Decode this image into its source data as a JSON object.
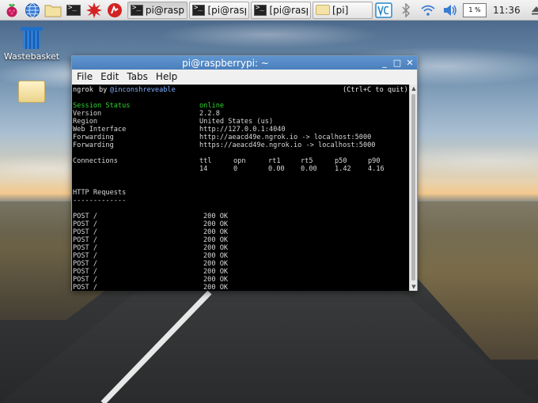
{
  "taskbar": {
    "tasks": [
      {
        "label": "pi@raspb",
        "kind": "terminal",
        "active": true
      },
      {
        "label": "[pi@rasp",
        "kind": "terminal",
        "active": false
      },
      {
        "label": "[pi@rasp",
        "kind": "terminal",
        "active": false
      },
      {
        "label": "[pi]",
        "kind": "folder",
        "active": false
      }
    ],
    "cpu": "1 %",
    "clock": "11:36"
  },
  "desktop": {
    "icons": [
      {
        "label": "Wastebasket",
        "icon": "wastebasket-icon"
      },
      {
        "label": "",
        "icon": "folder-icon"
      }
    ]
  },
  "window": {
    "title": "pi@raspberrypi: ~",
    "menu": [
      "File",
      "Edit",
      "Tabs",
      "Help"
    ]
  },
  "terminal": {
    "header": {
      "name": "ngrok",
      "by": "by",
      "author": "@inconshreveable",
      "quit_hint": "(Ctrl+C to quit)"
    },
    "status": [
      {
        "label": "Session Status",
        "value": "online"
      },
      {
        "label": "Version",
        "value": "2.2.8"
      },
      {
        "label": "Region",
        "value": "United States (us)"
      },
      {
        "label": "Web Interface",
        "value": "http://127.0.0.1:4040"
      },
      {
        "label": "Forwarding",
        "value": "http://aeacd49e.ngrok.io -> localhost:5000"
      },
      {
        "label": "Forwarding",
        "value": "https://aeacd49e.ngrok.io -> localhost:5000"
      }
    ],
    "connections": {
      "label": "Connections",
      "headers": [
        "ttl",
        "opn",
        "rt1",
        "rt5",
        "p50",
        "p90"
      ],
      "values": [
        "14",
        "0",
        "0.00",
        "0.00",
        "1.42",
        "4.16"
      ]
    },
    "http": {
      "title": "HTTP Requests",
      "divider": "-------------",
      "requests": [
        {
          "method": "POST /",
          "status": "200 OK"
        },
        {
          "method": "POST /",
          "status": "200 OK"
        },
        {
          "method": "POST /",
          "status": "200 OK"
        },
        {
          "method": "POST /",
          "status": "200 OK"
        },
        {
          "method": "POST /",
          "status": "200 OK"
        },
        {
          "method": "POST /",
          "status": "200 OK"
        },
        {
          "method": "POST /",
          "status": "200 OK"
        },
        {
          "method": "POST /",
          "status": "200 OK"
        },
        {
          "method": "POST /",
          "status": "200 OK"
        },
        {
          "method": "POST /",
          "status": "200 OK"
        }
      ]
    }
  }
}
